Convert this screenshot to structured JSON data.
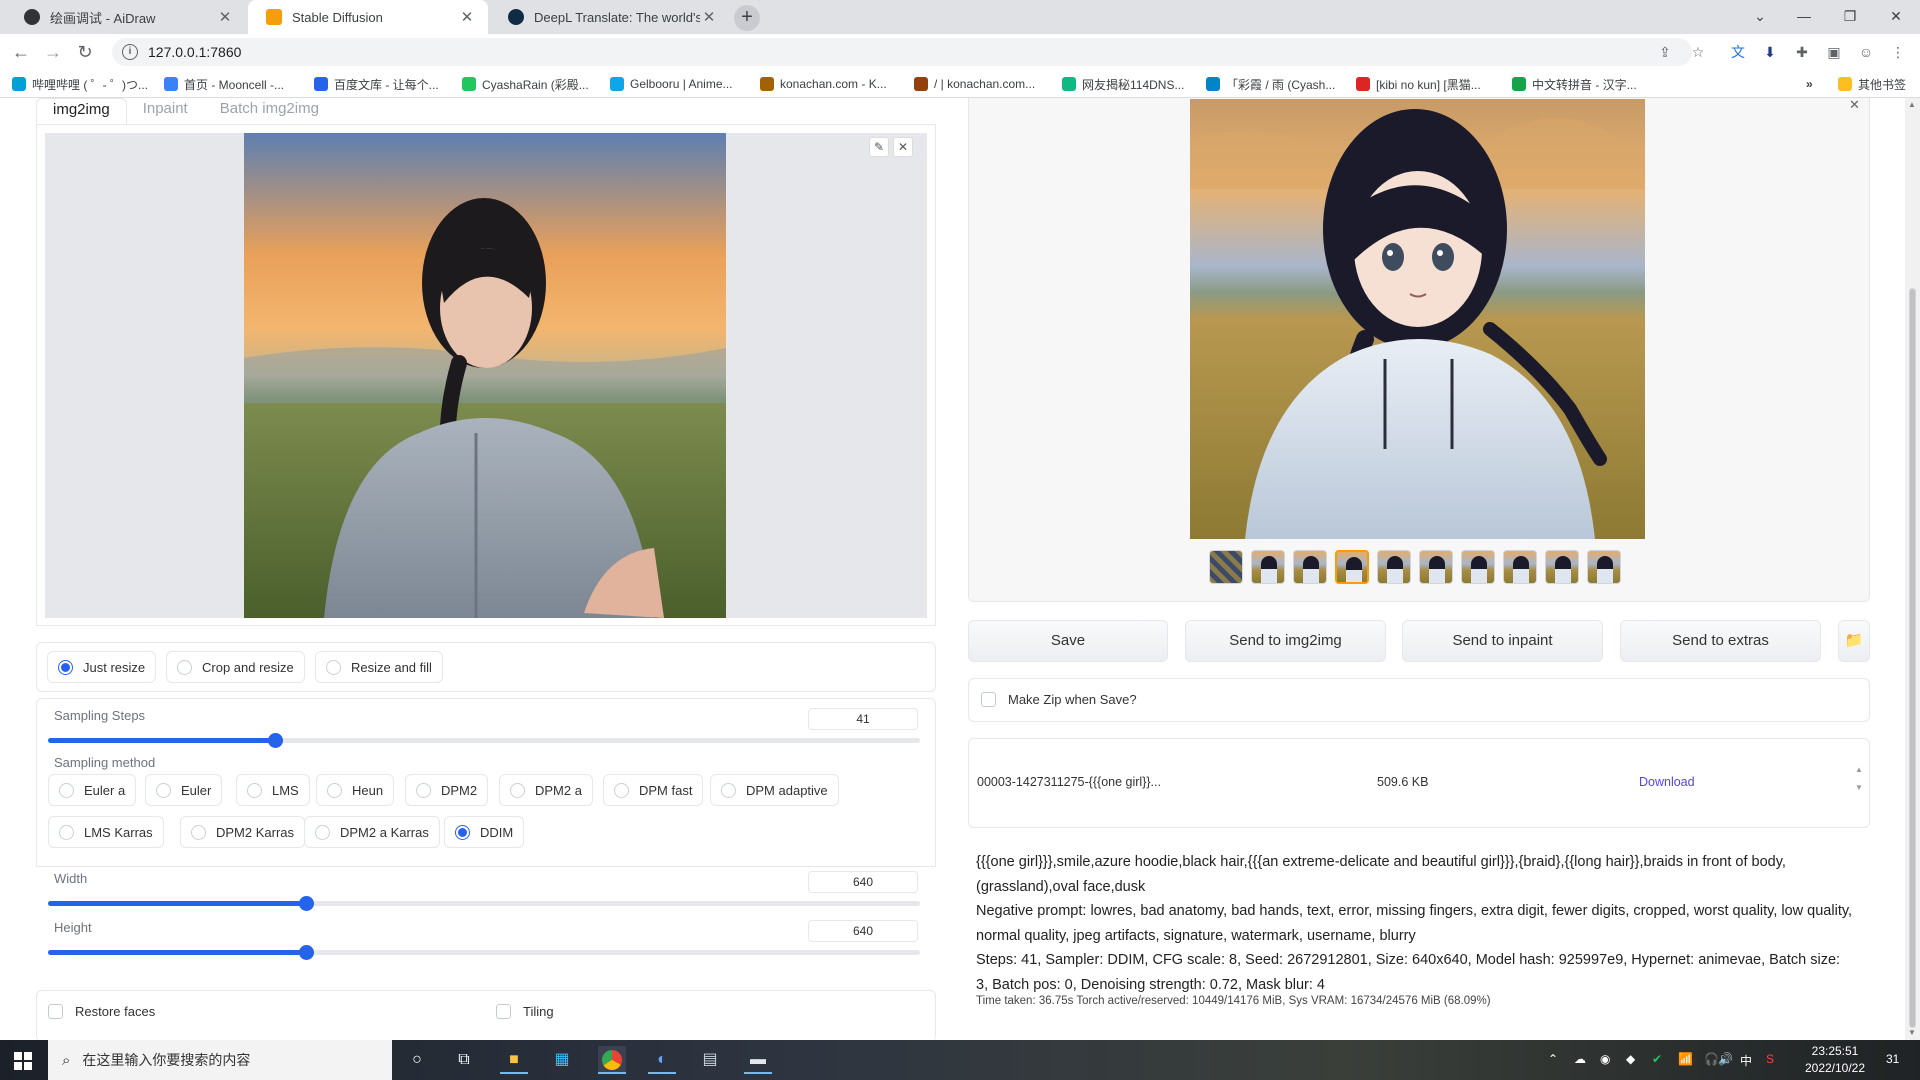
{
  "browser": {
    "tabs": [
      {
        "title": "绘画调试 - AiDraw",
        "active": false,
        "favicon_color": "#333333"
      },
      {
        "title": "Stable Diffusion",
        "active": true,
        "favicon_color": "#f59e0b"
      },
      {
        "title": "DeepL Translate: The world's most",
        "active": false,
        "favicon_color": "#0f2b46"
      }
    ],
    "url": "127.0.0.1:7860",
    "bookmarks": [
      {
        "label": "哔哩哔哩 ( ゜- ゜)つ...",
        "color": "#00a1d6"
      },
      {
        "label": "首页 - Mooncell -...",
        "color": "#3b82f6"
      },
      {
        "label": "百度文库 - 让每个...",
        "color": "#2563eb"
      },
      {
        "label": "CyashaRain (彩殿...",
        "color": "#22c55e"
      },
      {
        "label": "Gelbooru | Anime...",
        "color": "#0ea5e9"
      },
      {
        "label": "konachan.com - K...",
        "color": "#a16207"
      },
      {
        "label": "/ | konachan.com...",
        "color": "#92400e"
      },
      {
        "label": "网友揭秘114DNS...",
        "color": "#10b981"
      },
      {
        "label": "「彩霞 / 雨 (Cyash...",
        "color": "#0284c7"
      },
      {
        "label": "[kibi no kun] [黑猫...",
        "color": "#dc2626"
      },
      {
        "label": "中文转拼音 - 汉字...",
        "color": "#16a34a"
      }
    ],
    "other_bookmarks": "其他书签",
    "more_bookmarks": "»"
  },
  "img2img": {
    "tabs": [
      "img2img",
      "Inpaint",
      "Batch img2img"
    ],
    "resize_modes": [
      {
        "label": "Just resize",
        "selected": true
      },
      {
        "label": "Crop and resize",
        "selected": false
      },
      {
        "label": "Resize and fill",
        "selected": false
      }
    ],
    "sampling_steps": {
      "label": "Sampling Steps",
      "value": "41",
      "fraction": 0.26
    },
    "sampling_method": {
      "label": "Sampling method",
      "options": [
        {
          "label": "Euler a",
          "selected": false
        },
        {
          "label": "Euler",
          "selected": false
        },
        {
          "label": "LMS",
          "selected": false
        },
        {
          "label": "Heun",
          "selected": false
        },
        {
          "label": "DPM2",
          "selected": false
        },
        {
          "label": "DPM2 a",
          "selected": false
        },
        {
          "label": "DPM fast",
          "selected": false
        },
        {
          "label": "DPM adaptive",
          "selected": false
        },
        {
          "label": "LMS Karras",
          "selected": false
        },
        {
          "label": "DPM2 Karras",
          "selected": false
        },
        {
          "label": "DPM2 a Karras",
          "selected": false
        },
        {
          "label": "DDIM",
          "selected": true
        }
      ]
    },
    "width": {
      "label": "Width",
      "value": "640",
      "fraction": 0.296
    },
    "height": {
      "label": "Height",
      "value": "640",
      "fraction": 0.296
    },
    "restore_faces": "Restore faces",
    "tiling": "Tiling"
  },
  "output": {
    "selected_thumbnail": 3,
    "thumbnail_count": 10,
    "buttons": {
      "save": "Save",
      "send_img2img": "Send to img2img",
      "send_inpaint": "Send to inpaint",
      "send_extras": "Send to extras"
    },
    "make_zip": "Make Zip when Save?",
    "file": {
      "name": "00003-1427311275-{{{one girl}}...",
      "size": "509.6 KB",
      "download": "Download"
    },
    "info_prompt": "{{{one girl}}},smile,azure hoodie,black hair,{{{an extreme-delicate and beautiful girl}}},{braid},{{long hair}},braids in front of body,(grassland),oval face,dusk",
    "info_negative": "Negative prompt: lowres, bad anatomy, bad hands, text, error, missing fingers, extra digit, fewer digits, cropped, worst quality, low quality, normal quality, jpeg artifacts, signature, watermark, username, blurry",
    "info_params": "Steps: 41, Sampler: DDIM, CFG scale: 8, Seed: 2672912801, Size: 640x640, Model hash: 925997e9, Hypernet: animevae, Batch size: 3, Batch pos: 0, Denoising strength: 0.72, Mask blur: 4",
    "timing": "Time taken: 36.75s  Torch active/reserved: 10449/14176 MiB, Sys VRAM: 16734/24576 MiB (68.09%)"
  },
  "taskbar": {
    "search_placeholder": "在这里输入你要搜索的内容",
    "time": "23:25:51",
    "date": "2022/10/22",
    "ime": "中",
    "notification_count": "31"
  },
  "icons": [
    "back-icon",
    "forward-icon",
    "reload-icon",
    "info-icon",
    "share-icon",
    "star-icon",
    "translate-icon",
    "extensions-icon",
    "sidepanel-icon",
    "profile-icon",
    "menu-icon",
    "pencil-icon",
    "close-icon",
    "folder-icon",
    "windows-start-icon",
    "search-icon",
    "cortana-icon",
    "taskview-icon"
  ]
}
